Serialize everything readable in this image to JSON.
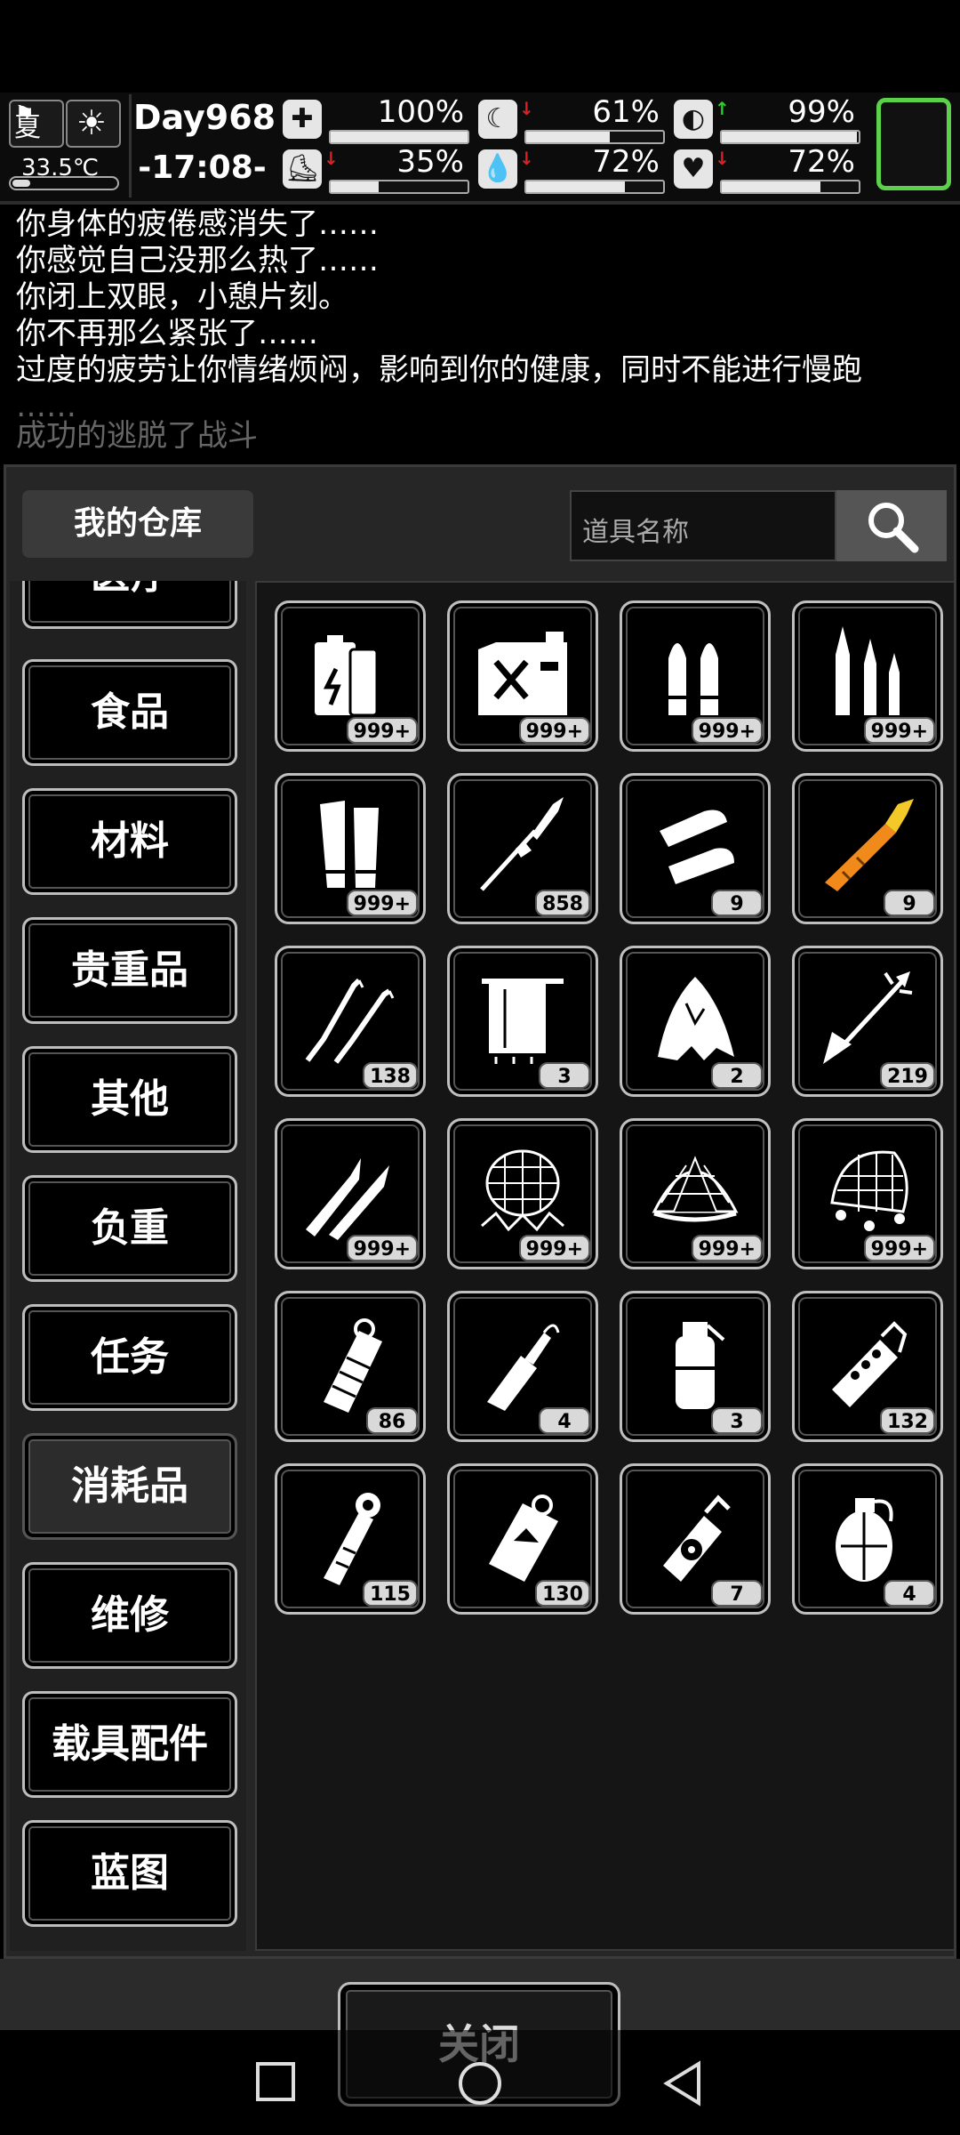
{
  "hud": {
    "season": "夏",
    "temperature": "33.5℃",
    "day": "Day968",
    "time": "-17:08-",
    "stats": [
      {
        "icon": "medkit-icon",
        "value": "100%",
        "level": 1.0,
        "arrow": "",
        "arrow_color": ""
      },
      {
        "icon": "stomach-icon",
        "value": "61%",
        "level": 0.61,
        "arrow": "↓",
        "arrow_color": "#e02020"
      },
      {
        "icon": "bladder-icon",
        "value": "99%",
        "level": 0.99,
        "arrow": "↑",
        "arrow_color": "#2bd12b"
      },
      {
        "icon": "boot-icon",
        "value": "35%",
        "level": 0.35,
        "arrow": "↓",
        "arrow_color": "#e02020"
      },
      {
        "icon": "water-drop-icon",
        "value": "72%",
        "level": 0.72,
        "arrow": "↓",
        "arrow_color": "#e02020"
      },
      {
        "icon": "heart-icon",
        "value": "72%",
        "level": 0.72,
        "arrow": "↓",
        "arrow_color": "#e02020"
      }
    ]
  },
  "log": [
    "你身体的疲倦感消失了……",
    "你感觉自己没那么热了……",
    "你闭上双眼，小憩片刻。",
    "你不再那么紧张了……",
    "过度的疲劳让你情绪烦闷，影响到你的健康，同时不能进行慢跑",
    "……",
    "成功的逃脱了战斗"
  ],
  "warehouse": {
    "title": "我的仓库",
    "search_placeholder": "道具名称",
    "categories": [
      "医疗",
      "食品",
      "材料",
      "贵重品",
      "其他",
      "负重",
      "任务",
      "消耗品",
      "维修",
      "载具配件",
      "蓝图"
    ],
    "active_category": "消耗品",
    "items": [
      {
        "icon": "battery-icon",
        "count": "999+"
      },
      {
        "icon": "fuel-can-icon",
        "count": "999+"
      },
      {
        "icon": "pistol-bullets-icon",
        "count": "999+"
      },
      {
        "icon": "rifle-bullets-icon",
        "count": "999+"
      },
      {
        "icon": "shotgun-shells-icon",
        "count": "999+"
      },
      {
        "icon": "rpg-rocket-icon",
        "count": "858"
      },
      {
        "icon": "large-bullets-icon",
        "count": "9"
      },
      {
        "icon": "orange-rocket-icon",
        "count": "9"
      },
      {
        "icon": "lockpick-icon",
        "count": "138"
      },
      {
        "icon": "towel-icon",
        "count": "3"
      },
      {
        "icon": "torn-cloth-icon",
        "count": "2"
      },
      {
        "icon": "arrow-icon",
        "count": "219"
      },
      {
        "icon": "darts-icon",
        "count": "999+"
      },
      {
        "icon": "spiked-net-icon",
        "count": "999+"
      },
      {
        "icon": "net-icon",
        "count": "999+"
      },
      {
        "icon": "weighted-net-icon",
        "count": "999+"
      },
      {
        "icon": "flashbang-icon",
        "count": "86"
      },
      {
        "icon": "molotov-icon",
        "count": "4"
      },
      {
        "icon": "smoke-grenade-icon",
        "count": "3"
      },
      {
        "icon": "stun-grenade-icon",
        "count": "132"
      },
      {
        "icon": "stick-grenade-icon",
        "count": "115"
      },
      {
        "icon": "c4-charge-icon",
        "count": "130"
      },
      {
        "icon": "radiation-spray-icon",
        "count": "7"
      },
      {
        "icon": "frag-grenade-icon",
        "count": "4"
      }
    ]
  },
  "close_label": "关闭",
  "nav": [
    "recents-icon",
    "home-icon",
    "back-icon"
  ]
}
